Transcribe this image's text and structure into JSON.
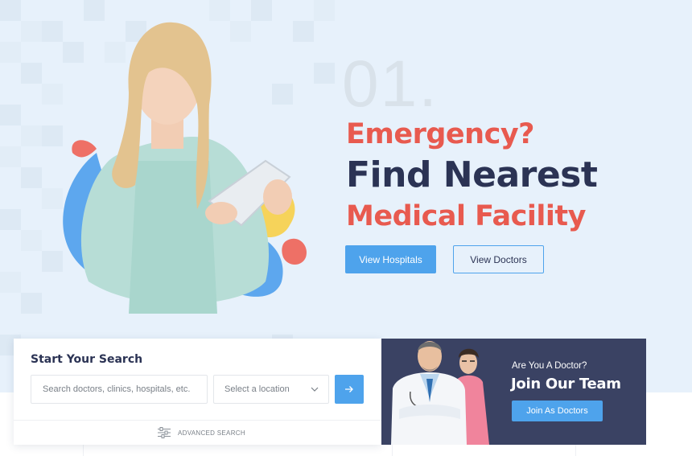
{
  "hero": {
    "step_number": "01.",
    "headline_1": "Emergency?",
    "headline_2": "Find Nearest",
    "headline_3": "Medical Facility",
    "primary_button": "View Hospitals",
    "secondary_button": "View Doctors"
  },
  "search": {
    "title": "Start Your Search",
    "placeholder": "Search doctors, clinics, hospitals, etc.",
    "location_value": "Select a location",
    "advanced_label": "ADVANCED SEARCH",
    "icons": {
      "submit": "arrow-right-icon",
      "select": "chevron-down-icon",
      "advanced": "sliders-icon"
    }
  },
  "doctor_cta": {
    "question": "Are You A Doctor?",
    "title": "Join Our Team",
    "button": "Join As Doctors"
  },
  "colors": {
    "accent_blue": "#4ea3ec",
    "accent_red": "#e85a4f",
    "navy": "#2b3354",
    "card_navy": "#3a4263",
    "hero_bg": "#e7f1fb"
  }
}
